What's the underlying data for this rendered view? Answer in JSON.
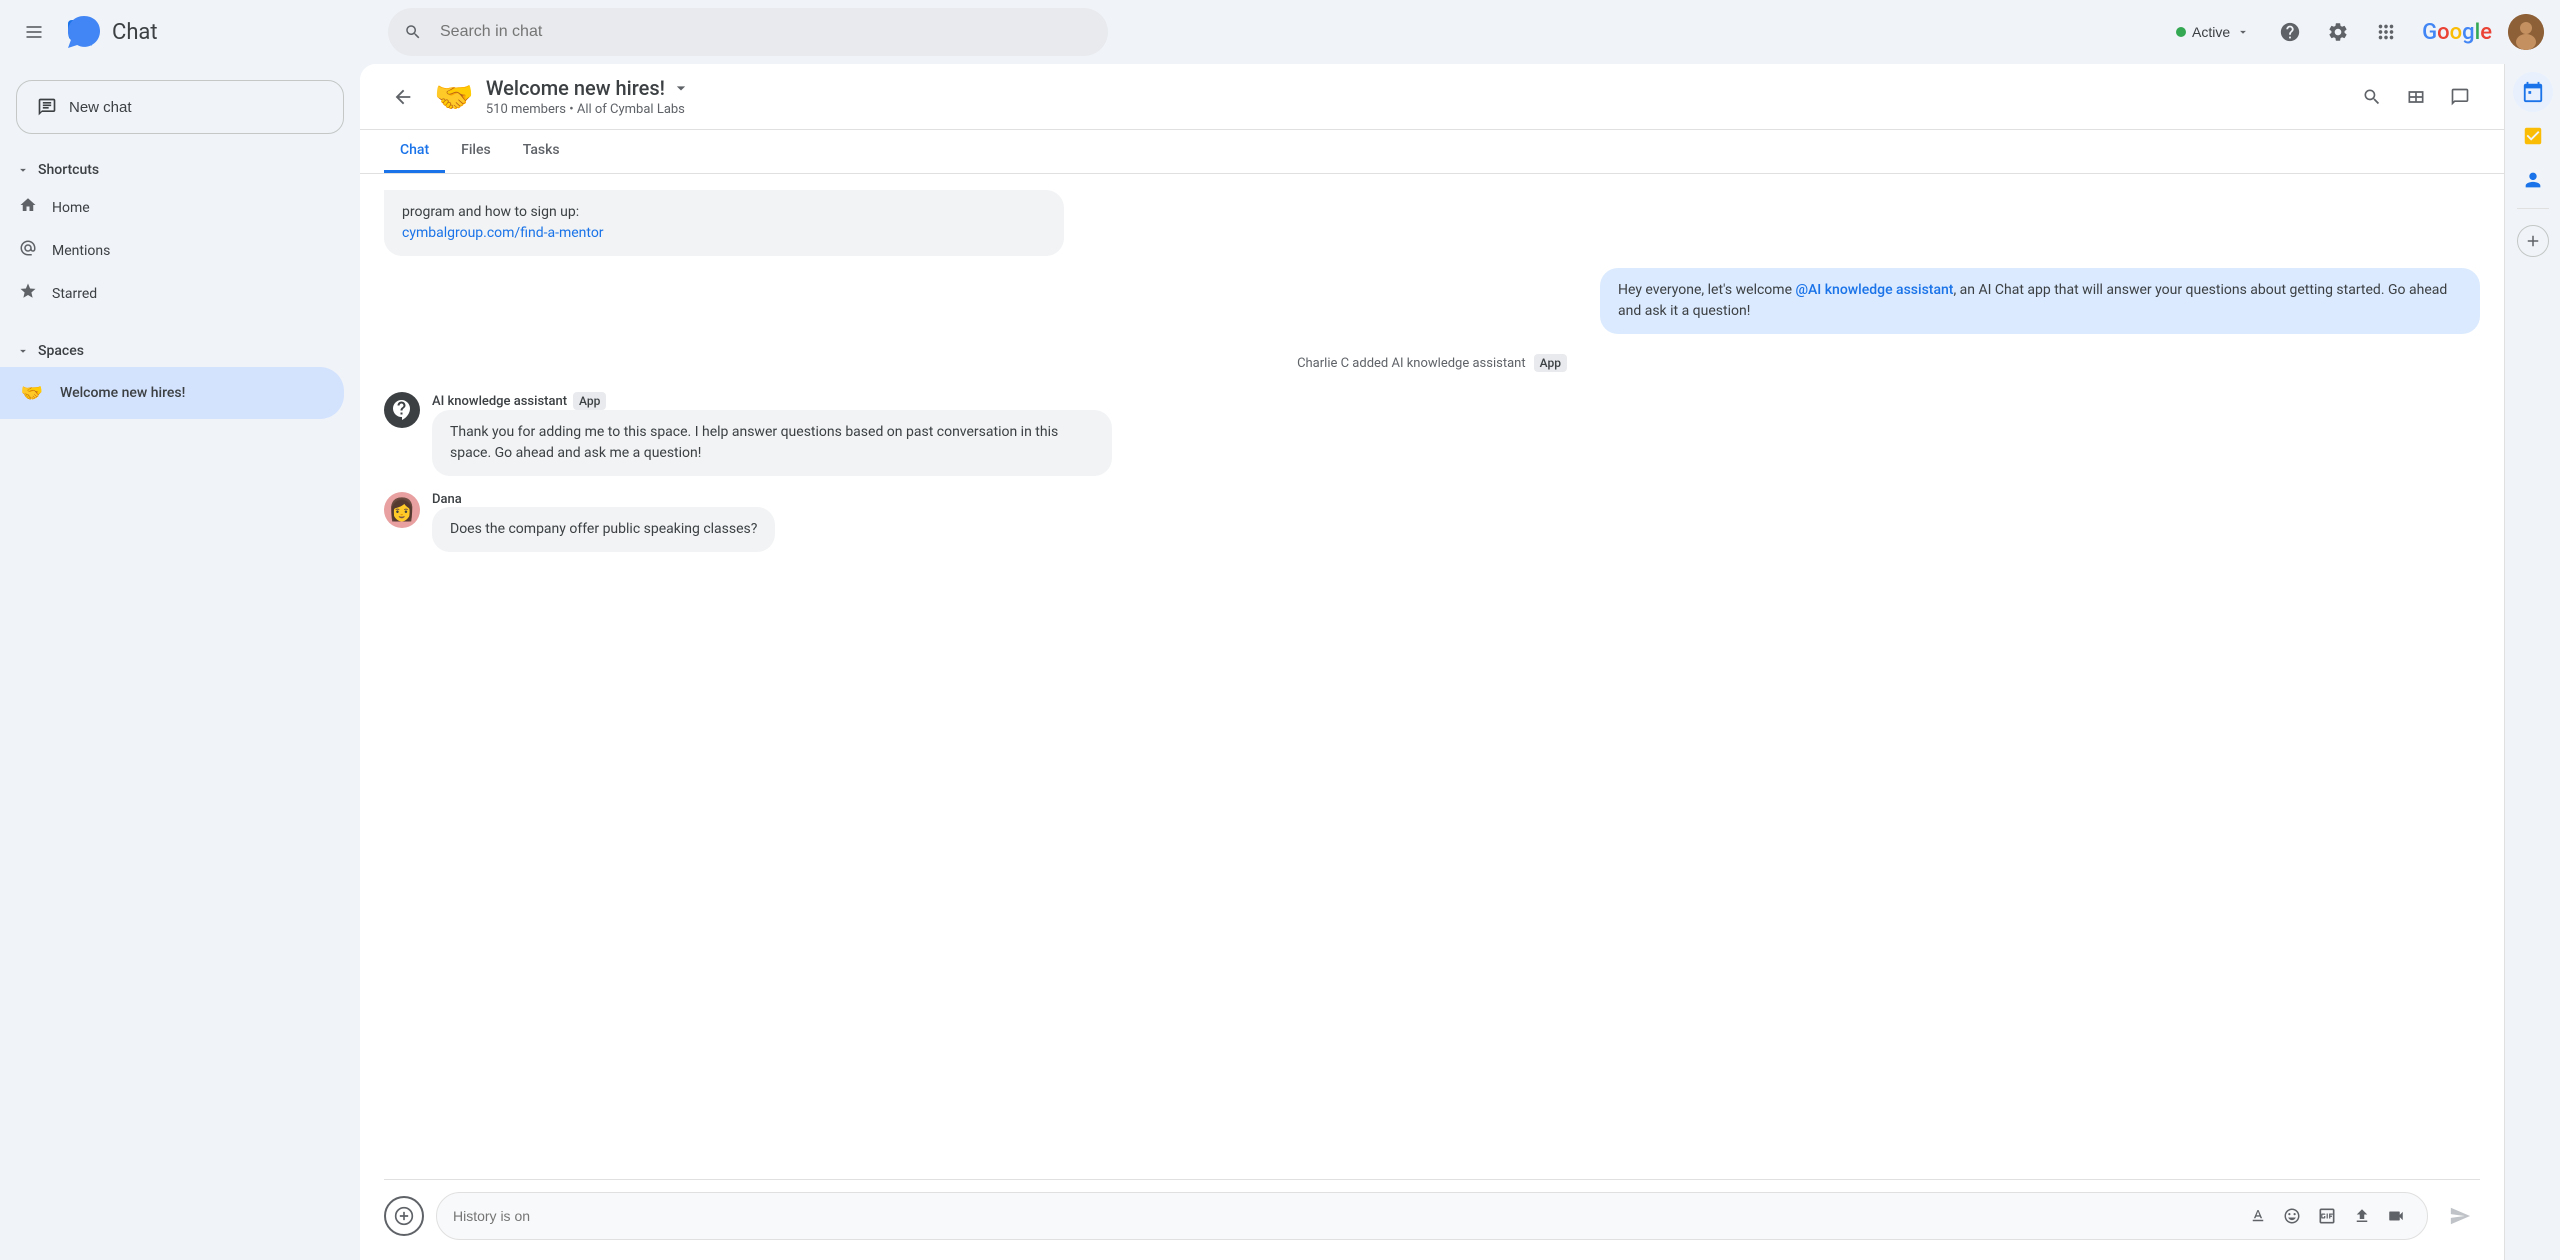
{
  "topbar": {
    "app_name": "Chat",
    "search_placeholder": "Search in chat",
    "status_label": "Active",
    "help_icon": "?",
    "settings_icon": "⚙",
    "grid_icon": "⠿",
    "google_label": "Google",
    "hamburger_icon": "☰"
  },
  "sidebar": {
    "new_chat_label": "New chat",
    "shortcuts_label": "Shortcuts",
    "home_label": "Home",
    "mentions_label": "Mentions",
    "starred_label": "Starred",
    "spaces_label": "Spaces",
    "space_item_label": "Welcome new hires!",
    "space_item_emoji": "🤝"
  },
  "chat_header": {
    "title": "Welcome new hires!",
    "emoji": "🤝",
    "member_count": "510 members",
    "org": "All of Cymbal Labs",
    "dropdown_icon": "▾"
  },
  "tabs": [
    {
      "label": "Chat",
      "active": true
    },
    {
      "label": "Files",
      "active": false
    },
    {
      "label": "Tasks",
      "active": false
    }
  ],
  "messages": [
    {
      "id": "msg1",
      "type": "partial_incoming",
      "text": "program and how to sign up:",
      "link_text": "cymbalgroup.com/find-a-mentor",
      "link_url": "#"
    },
    {
      "id": "msg2",
      "type": "outgoing",
      "text_before": "Hey everyone, let's welcome ",
      "mention": "@AI knowledge assistant",
      "text_after": ", an AI Chat app that will answer your questions about getting started.  Go ahead and ask it a question!"
    },
    {
      "id": "msg3",
      "type": "system",
      "text": "Charlie C added AI knowledge assistant",
      "badge": "App"
    },
    {
      "id": "msg4",
      "type": "incoming_with_avatar",
      "sender": "AI knowledge assistant",
      "sender_badge": "App",
      "avatar_emoji": "❓",
      "avatar_bg": "#3c4043",
      "text": "Thank you for adding me to this space. I help answer questions based on past conversation in this space. Go ahead and ask me a question!"
    },
    {
      "id": "msg5",
      "type": "incoming_with_avatar",
      "sender": "Dana",
      "avatar_emoji": "👩",
      "avatar_bg": "#e8a0a0",
      "text": "Does the company offer public speaking classes?"
    }
  ],
  "input": {
    "placeholder": "History is on",
    "add_icon": "+",
    "format_icon": "A",
    "emoji_icon": "☺",
    "gif_icon": "GIF",
    "upload_icon": "↑",
    "video_icon": "▭",
    "send_icon": "▶"
  },
  "right_sidebar": {
    "calendar_icon": "📅",
    "tasks_icon": "✓",
    "contacts_icon": "👤",
    "add_icon": "+"
  }
}
